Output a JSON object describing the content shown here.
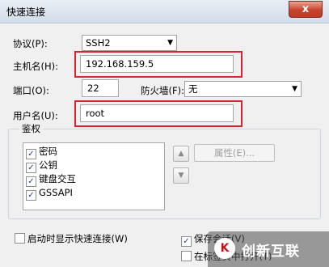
{
  "window": {
    "title": "快速连接",
    "close_glyph": "x"
  },
  "form": {
    "protocol_label": "协议(P):",
    "protocol_value": "SSH2",
    "hostname_label": "主机名(H):",
    "hostname_value": "192.168.159.5",
    "port_label": "端口(O):",
    "port_value": "22",
    "firewall_label": "防火墙(F):",
    "firewall_value": "无",
    "username_label": "用户名(U):",
    "username_value": "root"
  },
  "auth": {
    "legend": "鉴权",
    "items": [
      {
        "label": "密码",
        "checked": true
      },
      {
        "label": "公钥",
        "checked": true
      },
      {
        "label": "键盘交互",
        "checked": true
      },
      {
        "label": "GSSAPI",
        "checked": true
      }
    ],
    "properties_button": "属性(E)..."
  },
  "options": {
    "show_on_startup_label": "启动时显示快速连接(W)",
    "show_on_startup_checked": false,
    "save_session_label": "保存会话(V)",
    "save_session_checked": true,
    "open_in_tab_label": "在标签页中打开(T)",
    "open_in_tab_checked": false
  },
  "watermark": {
    "logo_text": "K",
    "text": "创新互联"
  },
  "colors": {
    "highlight_box": "#d9242f",
    "titlebar": "#dde4ef"
  }
}
